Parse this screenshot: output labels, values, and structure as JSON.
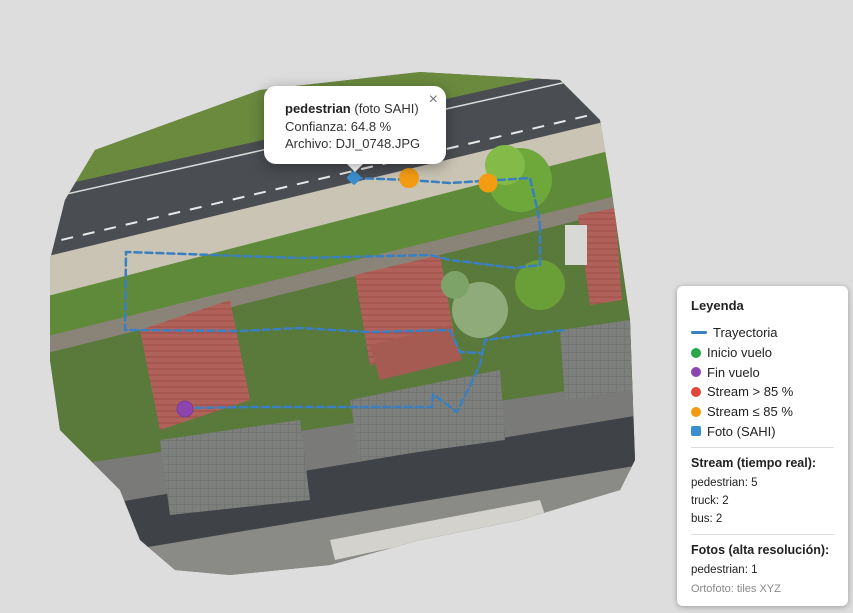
{
  "popup": {
    "title": "pedestrian",
    "source": "(foto SAHI)",
    "confidence_line": "Confianza: 64.8 %",
    "file_line": "Archivo: DJI_0748.JPG",
    "close_label": "×"
  },
  "legend": {
    "title": "Leyenda",
    "items": [
      {
        "label": "Trayectoria",
        "symbol": "line",
        "color": "#3a7fc0"
      },
      {
        "label": "Inicio vuelo",
        "symbol": "dot",
        "color": "#27a84a"
      },
      {
        "label": "Fin vuelo",
        "symbol": "dot",
        "color": "#8e44ad"
      },
      {
        "label": "Stream > 85 %",
        "symbol": "dot",
        "color": "#e0463c"
      },
      {
        "label": "Stream ≤ 85 %",
        "symbol": "dot",
        "color": "#f39c12"
      },
      {
        "label": "Foto (SAHI)",
        "symbol": "square",
        "color": "#3a8fd0"
      }
    ],
    "stream_title": "Stream (tiempo real):",
    "stream_counts": [
      "pedestrian: 5",
      "truck: 2",
      "bus: 2"
    ],
    "photos_title": "Fotos (alta resolución):",
    "photo_counts": [
      "pedestrian: 1"
    ],
    "footer": "Ortofoto: tiles XYZ"
  }
}
